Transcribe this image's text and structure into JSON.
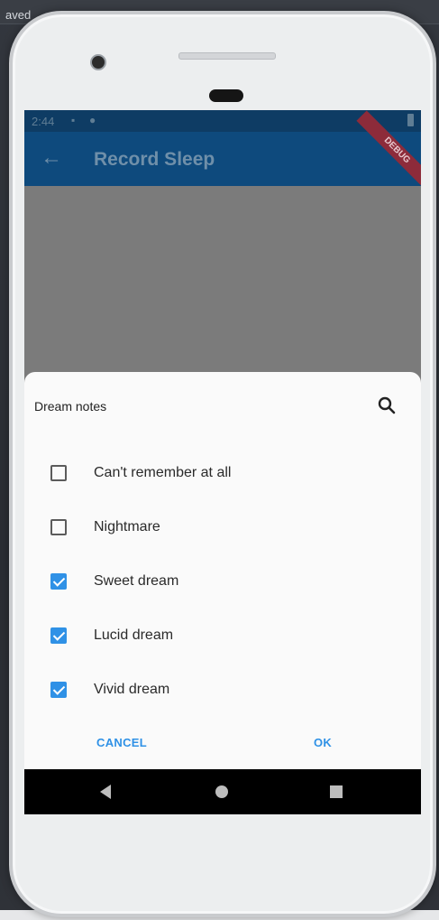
{
  "host": {
    "label": "aved"
  },
  "status_bar": {
    "time": "2:44",
    "icons": [
      "sim-icon",
      "notification-icon"
    ]
  },
  "app_bar": {
    "title": "Record Sleep",
    "back_icon": "arrow-back-icon",
    "debug_banner": "DEBUG"
  },
  "dialog": {
    "title": "Dream notes",
    "search_icon": "search-icon",
    "options": [
      {
        "label": "Can't remember at all",
        "checked": false
      },
      {
        "label": "Nightmare",
        "checked": false
      },
      {
        "label": "Sweet dream",
        "checked": true
      },
      {
        "label": "Lucid dream",
        "checked": true
      },
      {
        "label": "Vivid dream",
        "checked": true
      }
    ],
    "cancel_label": "CANCEL",
    "ok_label": "OK"
  },
  "nav_bar": {
    "back": "nav-back-icon",
    "home": "nav-home-icon",
    "recent": "nav-recent-icon"
  },
  "colors": {
    "accent": "#2f91e6",
    "app_bar": "#0e4a7d",
    "scrim": "#7b7b7b"
  }
}
